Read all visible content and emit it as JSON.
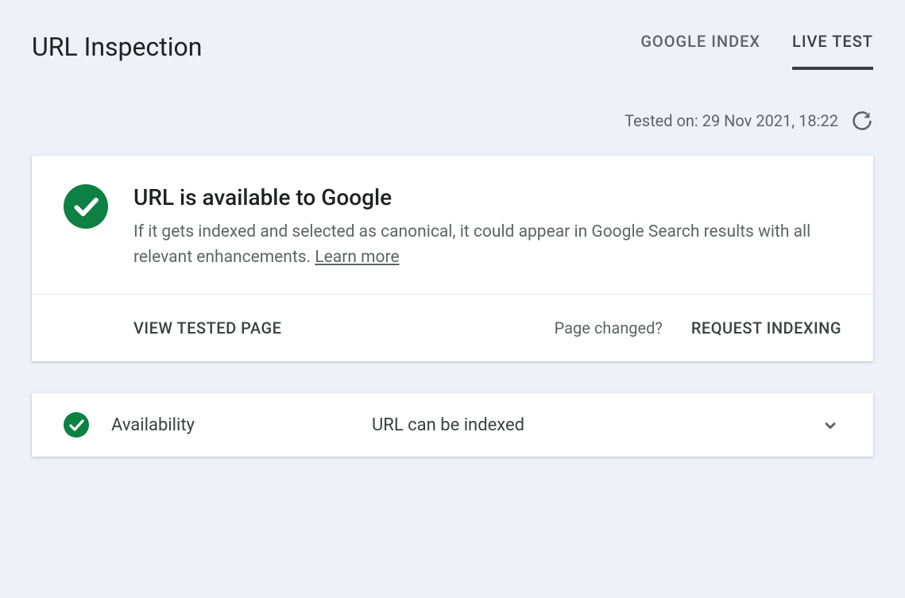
{
  "header": {
    "title": "URL Inspection",
    "tabs": [
      {
        "label": "GOOGLE INDEX",
        "active": false
      },
      {
        "label": "LIVE TEST",
        "active": true
      }
    ]
  },
  "tested": {
    "label": "Tested on: 29 Nov 2021, 18:22"
  },
  "status_card": {
    "title": "URL is available to Google",
    "description": "If it gets indexed and selected as canonical, it could appear in Google Search results with all relevant enhancements. ",
    "learn_more": "Learn more",
    "actions": {
      "view_tested": "VIEW TESTED PAGE",
      "page_changed": "Page changed?",
      "request_indexing": "REQUEST INDEXING"
    }
  },
  "availability": {
    "label": "Availability",
    "value": "URL can be indexed"
  }
}
